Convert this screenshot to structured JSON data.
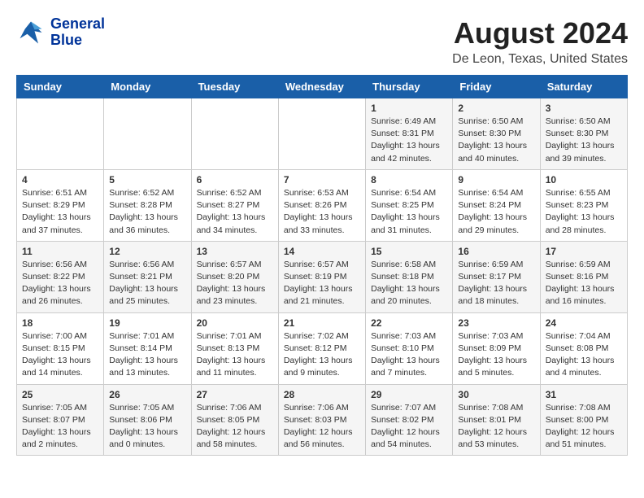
{
  "header": {
    "logo_line1": "General",
    "logo_line2": "Blue",
    "main_title": "August 2024",
    "subtitle": "De Leon, Texas, United States"
  },
  "weekdays": [
    "Sunday",
    "Monday",
    "Tuesday",
    "Wednesday",
    "Thursday",
    "Friday",
    "Saturday"
  ],
  "weeks": [
    [
      {
        "day": "",
        "info": ""
      },
      {
        "day": "",
        "info": ""
      },
      {
        "day": "",
        "info": ""
      },
      {
        "day": "",
        "info": ""
      },
      {
        "day": "1",
        "info": "Sunrise: 6:49 AM\nSunset: 8:31 PM\nDaylight: 13 hours\nand 42 minutes."
      },
      {
        "day": "2",
        "info": "Sunrise: 6:50 AM\nSunset: 8:30 PM\nDaylight: 13 hours\nand 40 minutes."
      },
      {
        "day": "3",
        "info": "Sunrise: 6:50 AM\nSunset: 8:30 PM\nDaylight: 13 hours\nand 39 minutes."
      }
    ],
    [
      {
        "day": "4",
        "info": "Sunrise: 6:51 AM\nSunset: 8:29 PM\nDaylight: 13 hours\nand 37 minutes."
      },
      {
        "day": "5",
        "info": "Sunrise: 6:52 AM\nSunset: 8:28 PM\nDaylight: 13 hours\nand 36 minutes."
      },
      {
        "day": "6",
        "info": "Sunrise: 6:52 AM\nSunset: 8:27 PM\nDaylight: 13 hours\nand 34 minutes."
      },
      {
        "day": "7",
        "info": "Sunrise: 6:53 AM\nSunset: 8:26 PM\nDaylight: 13 hours\nand 33 minutes."
      },
      {
        "day": "8",
        "info": "Sunrise: 6:54 AM\nSunset: 8:25 PM\nDaylight: 13 hours\nand 31 minutes."
      },
      {
        "day": "9",
        "info": "Sunrise: 6:54 AM\nSunset: 8:24 PM\nDaylight: 13 hours\nand 29 minutes."
      },
      {
        "day": "10",
        "info": "Sunrise: 6:55 AM\nSunset: 8:23 PM\nDaylight: 13 hours\nand 28 minutes."
      }
    ],
    [
      {
        "day": "11",
        "info": "Sunrise: 6:56 AM\nSunset: 8:22 PM\nDaylight: 13 hours\nand 26 minutes."
      },
      {
        "day": "12",
        "info": "Sunrise: 6:56 AM\nSunset: 8:21 PM\nDaylight: 13 hours\nand 25 minutes."
      },
      {
        "day": "13",
        "info": "Sunrise: 6:57 AM\nSunset: 8:20 PM\nDaylight: 13 hours\nand 23 minutes."
      },
      {
        "day": "14",
        "info": "Sunrise: 6:57 AM\nSunset: 8:19 PM\nDaylight: 13 hours\nand 21 minutes."
      },
      {
        "day": "15",
        "info": "Sunrise: 6:58 AM\nSunset: 8:18 PM\nDaylight: 13 hours\nand 20 minutes."
      },
      {
        "day": "16",
        "info": "Sunrise: 6:59 AM\nSunset: 8:17 PM\nDaylight: 13 hours\nand 18 minutes."
      },
      {
        "day": "17",
        "info": "Sunrise: 6:59 AM\nSunset: 8:16 PM\nDaylight: 13 hours\nand 16 minutes."
      }
    ],
    [
      {
        "day": "18",
        "info": "Sunrise: 7:00 AM\nSunset: 8:15 PM\nDaylight: 13 hours\nand 14 minutes."
      },
      {
        "day": "19",
        "info": "Sunrise: 7:01 AM\nSunset: 8:14 PM\nDaylight: 13 hours\nand 13 minutes."
      },
      {
        "day": "20",
        "info": "Sunrise: 7:01 AM\nSunset: 8:13 PM\nDaylight: 13 hours\nand 11 minutes."
      },
      {
        "day": "21",
        "info": "Sunrise: 7:02 AM\nSunset: 8:12 PM\nDaylight: 13 hours\nand 9 minutes."
      },
      {
        "day": "22",
        "info": "Sunrise: 7:03 AM\nSunset: 8:10 PM\nDaylight: 13 hours\nand 7 minutes."
      },
      {
        "day": "23",
        "info": "Sunrise: 7:03 AM\nSunset: 8:09 PM\nDaylight: 13 hours\nand 5 minutes."
      },
      {
        "day": "24",
        "info": "Sunrise: 7:04 AM\nSunset: 8:08 PM\nDaylight: 13 hours\nand 4 minutes."
      }
    ],
    [
      {
        "day": "25",
        "info": "Sunrise: 7:05 AM\nSunset: 8:07 PM\nDaylight: 13 hours\nand 2 minutes."
      },
      {
        "day": "26",
        "info": "Sunrise: 7:05 AM\nSunset: 8:06 PM\nDaylight: 13 hours\nand 0 minutes."
      },
      {
        "day": "27",
        "info": "Sunrise: 7:06 AM\nSunset: 8:05 PM\nDaylight: 12 hours\nand 58 minutes."
      },
      {
        "day": "28",
        "info": "Sunrise: 7:06 AM\nSunset: 8:03 PM\nDaylight: 12 hours\nand 56 minutes."
      },
      {
        "day": "29",
        "info": "Sunrise: 7:07 AM\nSunset: 8:02 PM\nDaylight: 12 hours\nand 54 minutes."
      },
      {
        "day": "30",
        "info": "Sunrise: 7:08 AM\nSunset: 8:01 PM\nDaylight: 12 hours\nand 53 minutes."
      },
      {
        "day": "31",
        "info": "Sunrise: 7:08 AM\nSunset: 8:00 PM\nDaylight: 12 hours\nand 51 minutes."
      }
    ]
  ]
}
